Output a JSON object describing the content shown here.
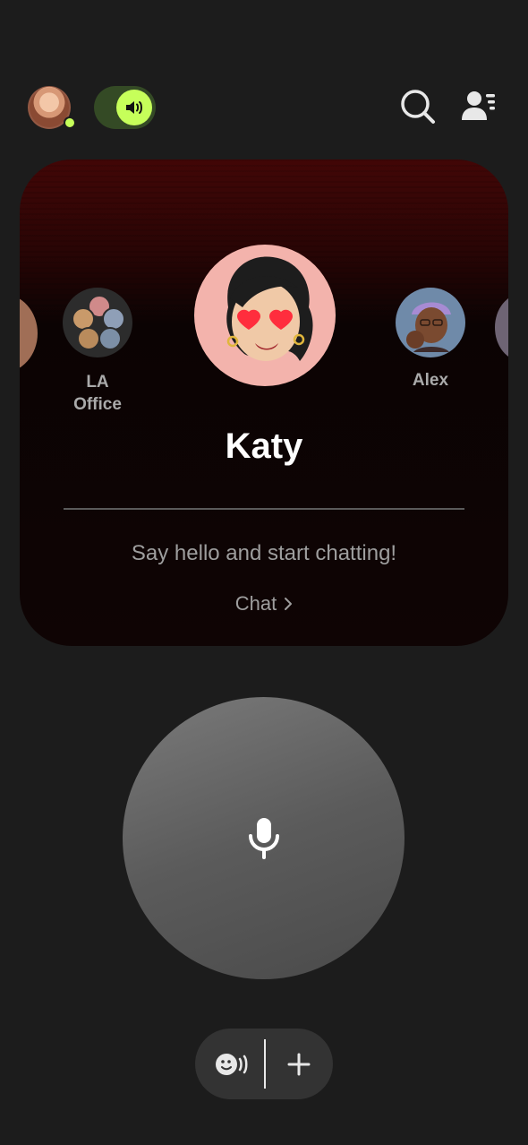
{
  "header": {
    "profile_avatar_icon": "profile-avatar",
    "online_color": "#c6ff5a",
    "sound_toggle_on": true,
    "sound_icon": "speaker-icon",
    "search_icon": "search-icon",
    "contacts_icon": "contacts-list-icon"
  },
  "carousel": {
    "contacts": [
      {
        "label": "LA Office",
        "label_line1": "LA",
        "label_line2": "Office",
        "type": "group"
      },
      {
        "label": "Katy",
        "type": "selected"
      },
      {
        "label": "Alex",
        "type": "contact"
      }
    ]
  },
  "card": {
    "name": "Katy",
    "prompt": "Say hello and start chatting!",
    "chat_label": "Chat"
  },
  "controls": {
    "talk_icon": "microphone-icon",
    "voice_icon": "emoji-voice-icon",
    "add_icon": "plus-icon"
  },
  "colors": {
    "background": "#1c1c1c",
    "accent": "#c6ff5a",
    "card_top": "#420606"
  }
}
